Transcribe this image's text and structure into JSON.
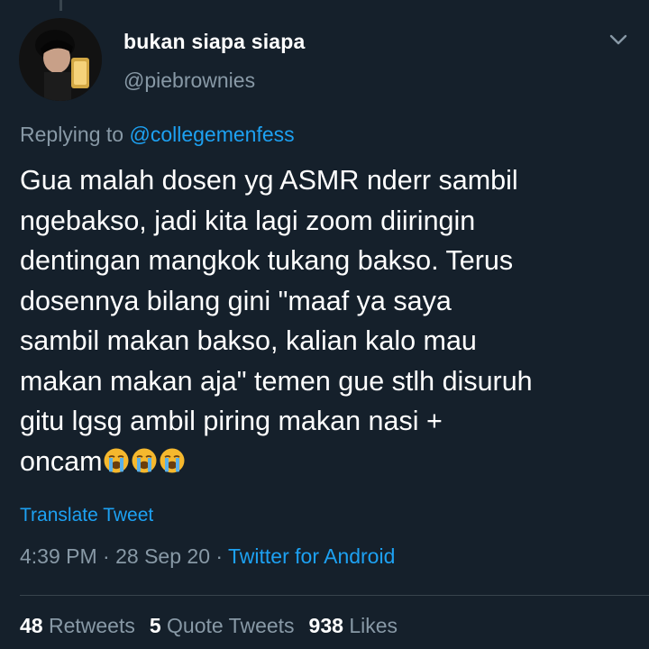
{
  "user": {
    "display_name": "bukan siapa siapa",
    "handle": "@piebrownies",
    "avatar": "profile-photo"
  },
  "reply": {
    "prefix": "Replying to ",
    "mention": "@collegemenfess"
  },
  "tweet": {
    "text": "Gua malah dosen yg ASMR nderr sambil\nngebakso, jadi kita lagi zoom diiringin\ndentingan mangkok tukang bakso. Terus\ndosennya bilang gini \"maaf ya saya\nsambil makan bakso, kalian kalo mau\nmakan makan aja\" temen gue stlh disuruh\ngitu lgsg ambil piring makan nasi +\noncam",
    "emojis": [
      "loudly-crying-face",
      "loudly-crying-face",
      "loudly-crying-face"
    ],
    "translate_label": "Translate Tweet"
  },
  "meta": {
    "time": "4:39 PM",
    "separator": " · ",
    "date": "28 Sep 20",
    "source": "Twitter for Android"
  },
  "stats": {
    "retweets_count": "48",
    "retweets_label": "Retweets",
    "quotes_count": "5",
    "quotes_label": "Quote Tweets",
    "likes_count": "938",
    "likes_label": "Likes"
  },
  "colors": {
    "background": "#15202b",
    "text": "#ffffff",
    "secondary": "#8899a6",
    "accent": "#1da1f2",
    "divider": "#38444d"
  },
  "icons": [
    "chevron-down-icon"
  ]
}
